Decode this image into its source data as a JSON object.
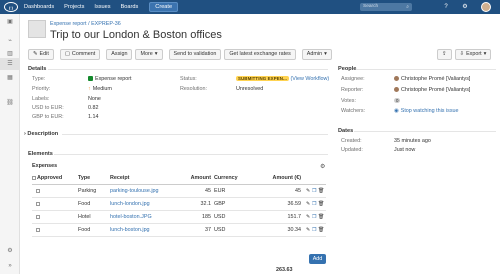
{
  "topnav": {
    "logo_text": "(·)",
    "links": [
      "Dashboards",
      "Projects",
      "Issues",
      "Boards"
    ],
    "create_label": "Create",
    "search_placeholder": "Search"
  },
  "issue": {
    "project": "Expense report",
    "key": "EXPREP-36",
    "summary": "Trip to our London & Boston offices"
  },
  "toolbar": {
    "edit": "Edit",
    "comment": "Comment",
    "assign": "Assign",
    "more": "More",
    "send": "Send to validation",
    "rates": "Get latest exchange rates",
    "admin": "Admin",
    "export": "Export"
  },
  "details": {
    "heading": "Details",
    "type_label": "Type:",
    "type_value": "Expense report",
    "priority_label": "Priority:",
    "priority_value": "Medium",
    "labels_label": "Labels:",
    "labels_value": "None",
    "usd_label": "USD to EUR:",
    "usd_value": "0.82",
    "gbp_label": "GBP to EUR:",
    "gbp_value": "1.14",
    "status_label": "Status:",
    "status_value": "SUBMITTING EXPEN...",
    "workflow_link": "(View Workflow)",
    "resolution_label": "Resolution:",
    "resolution_value": "Unresolved"
  },
  "description": {
    "heading": "Description"
  },
  "elements": {
    "heading": "Elements"
  },
  "people": {
    "heading": "People",
    "assignee_label": "Assignee:",
    "assignee_value": "Christophe Promé [Valiantys]",
    "reporter_label": "Reporter:",
    "reporter_value": "Christophe Promé [Valiantys]",
    "votes_label": "Votes:",
    "votes_value": "0",
    "watchers_label": "Watchers:",
    "watchers_link": "Stop watching this issue"
  },
  "dates": {
    "heading": "Dates",
    "created_label": "Created:",
    "created_value": "35 minutes ago",
    "updated_label": "Updated:",
    "updated_value": "Just now"
  },
  "expenses": {
    "title": "Expenses",
    "columns": [
      "Approved",
      "Type",
      "Receipt",
      "Amount",
      "Currency",
      "Amount (€)"
    ],
    "rows": [
      {
        "type": "Parking",
        "receipt": "parking-toulouse.jpg",
        "amount": "45",
        "currency": "EUR",
        "amount_eur": "45"
      },
      {
        "type": "Food",
        "receipt": "lunch-london.jpg",
        "amount": "32.1",
        "currency": "GBP",
        "amount_eur": "36.59"
      },
      {
        "type": "Hotel",
        "receipt": "hotel-boston.JPG",
        "amount": "185",
        "currency": "USD",
        "amount_eur": "151.7"
      },
      {
        "type": "Food",
        "receipt": "lunch-boston.jpg",
        "amount": "37",
        "currency": "USD",
        "amount_eur": "30.34"
      }
    ],
    "total": "263.63",
    "add_label": "Add"
  },
  "colors": {
    "topbar": "#205081",
    "link": "#3572b0",
    "status_lozenge": "#ffd351",
    "expense_type_icon": "#14892c",
    "priority_icon": "#f79232"
  }
}
